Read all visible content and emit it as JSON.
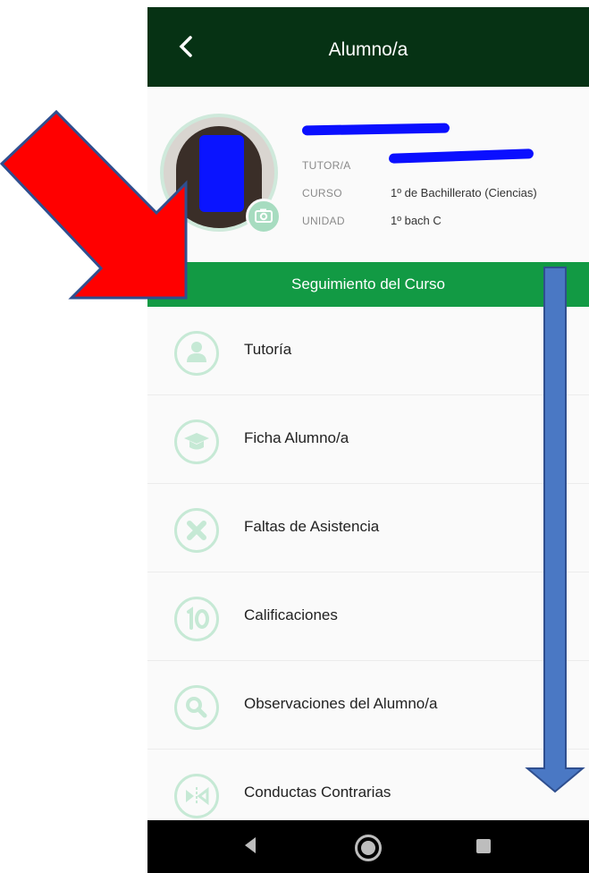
{
  "appbar": {
    "title": "Alumno/a",
    "back_icon": "chevron-left-icon"
  },
  "profile": {
    "labels": {
      "tutor": "TUTOR/A",
      "curso": "CURSO",
      "unidad": "UNIDAD"
    },
    "curso_value": "1º de Bachillerato (Ciencias)",
    "unidad_value": "1º bach C",
    "camera_icon": "camera-icon"
  },
  "section": {
    "title": "Seguimiento del Curso"
  },
  "menu": [
    {
      "label": "Tutoría",
      "icon": "person-icon"
    },
    {
      "label": "Ficha Alumno/a",
      "icon": "graduation-cap-icon"
    },
    {
      "label": "Faltas de Asistencia",
      "icon": "close-x-icon"
    },
    {
      "label": "Calificaciones",
      "icon": "ten-grade-icon"
    },
    {
      "label": "Observaciones del Alumno/a",
      "icon": "magnifier-icon"
    },
    {
      "label": "Conductas Contrarias",
      "icon": "split-arrows-icon"
    }
  ],
  "colors": {
    "appbar": "#063214",
    "accent": "#129a44",
    "icon_tint": "#c6e9d5",
    "annotation_red": "#ff0000",
    "annotation_blue": "#4a78c4"
  }
}
